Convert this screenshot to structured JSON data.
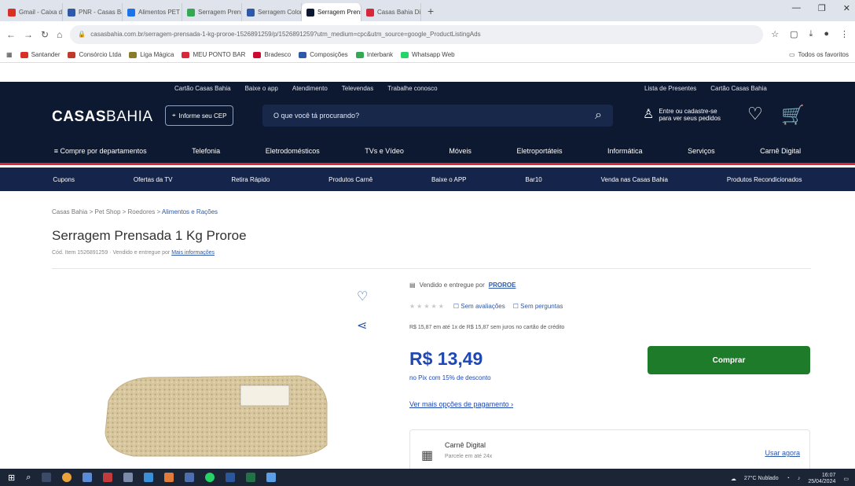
{
  "browser": {
    "tabs": [
      {
        "label": "Gmail - Caixa de entrada",
        "color": "#d93025",
        "active": false
      },
      {
        "label": "PNR - Casas Bahia",
        "color": "#2e59a8",
        "active": false
      },
      {
        "label": "Alimentos PET",
        "color": "#1a73e8",
        "active": false
      },
      {
        "label": "Serragem Prensada",
        "color": "#34a853",
        "active": false
      },
      {
        "label": "Serragem Colonial",
        "color": "#2e59a8",
        "active": false
      },
      {
        "label": "Serragem Prensada",
        "color": "#0d1930",
        "active": true
      },
      {
        "label": "Casas Bahia Digital",
        "color": "#d7283a",
        "active": false
      }
    ],
    "new_tab": "+",
    "url": "casasbahia.com.br/serragem-prensada-1-kg-proroe-1526891259/p/1526891259?utm_medium=cpc&utm_source=google_ProductListingAds",
    "bookmarks": [
      "Santander",
      "Consórcio Ltda",
      "Liga Mágica",
      "MEU PONTO BAR",
      "Bradesco",
      "Composições",
      "Interbank",
      "Whatsapp Web"
    ],
    "bookmarks_right": "Todos os favoritos"
  },
  "site": {
    "util_links": [
      "Cartão Casas Bahia",
      "Baixe o app",
      "Atendimento",
      "Televendas",
      "Trabalhe conosco"
    ],
    "util_right": [
      "Lista de Presentes",
      "Cartão Casas Bahia"
    ],
    "logo_bold": "CASAS",
    "logo_light": "BAHIA",
    "cep_button": "Informe seu CEP",
    "search_placeholder": "O que você tá procurando?",
    "account_line1": "Entre ou cadastre-se",
    "account_line2": "para ver seus pedidos",
    "departments": [
      "Compre por departamentos",
      "Telefonia",
      "Eletrodomésticos",
      "TVs e Vídeo",
      "Móveis",
      "Eletroportáteis",
      "Informática",
      "Serviços",
      "Carnê Digital"
    ],
    "subnav": [
      "Cupons",
      "Ofertas da TV",
      "Retira Rápido",
      "Produtos Carnê",
      "Baixe o APP",
      "Bar10",
      "Venda nas Casas Bahia",
      "Produtos Recondicionados"
    ]
  },
  "product": {
    "breadcrumb": [
      "Casas Bahia",
      "Pet Shop",
      "Roedores",
      "Alimentos e Rações"
    ],
    "title": "Serragem Prensada 1 Kg Proroe",
    "sku_text": "Cód. Item 1526891259 · Vendido e entregue por",
    "sku_link": "Mais informações",
    "sold_by": "Vendido e entregue por",
    "seller": "PROROE",
    "rating_empty": "Sem avaliações",
    "questions": "Sem perguntas",
    "installments": "R$ 15,87 em até 1x de R$ 15,87 sem juros no cartão de crédito",
    "price": "R$ 13,49",
    "pix": "no Pix com 15% de desconto",
    "more_payment": "Ver mais opções de pagamento",
    "buy_button": "Comprar",
    "card_title": "Carnê Digital",
    "card_sub": "Parcele em até 24x",
    "card_use": "Usar agora"
  },
  "taskbar": {
    "weather": "27°C Nublado",
    "time": "16:07",
    "date": "25/04/2024"
  }
}
